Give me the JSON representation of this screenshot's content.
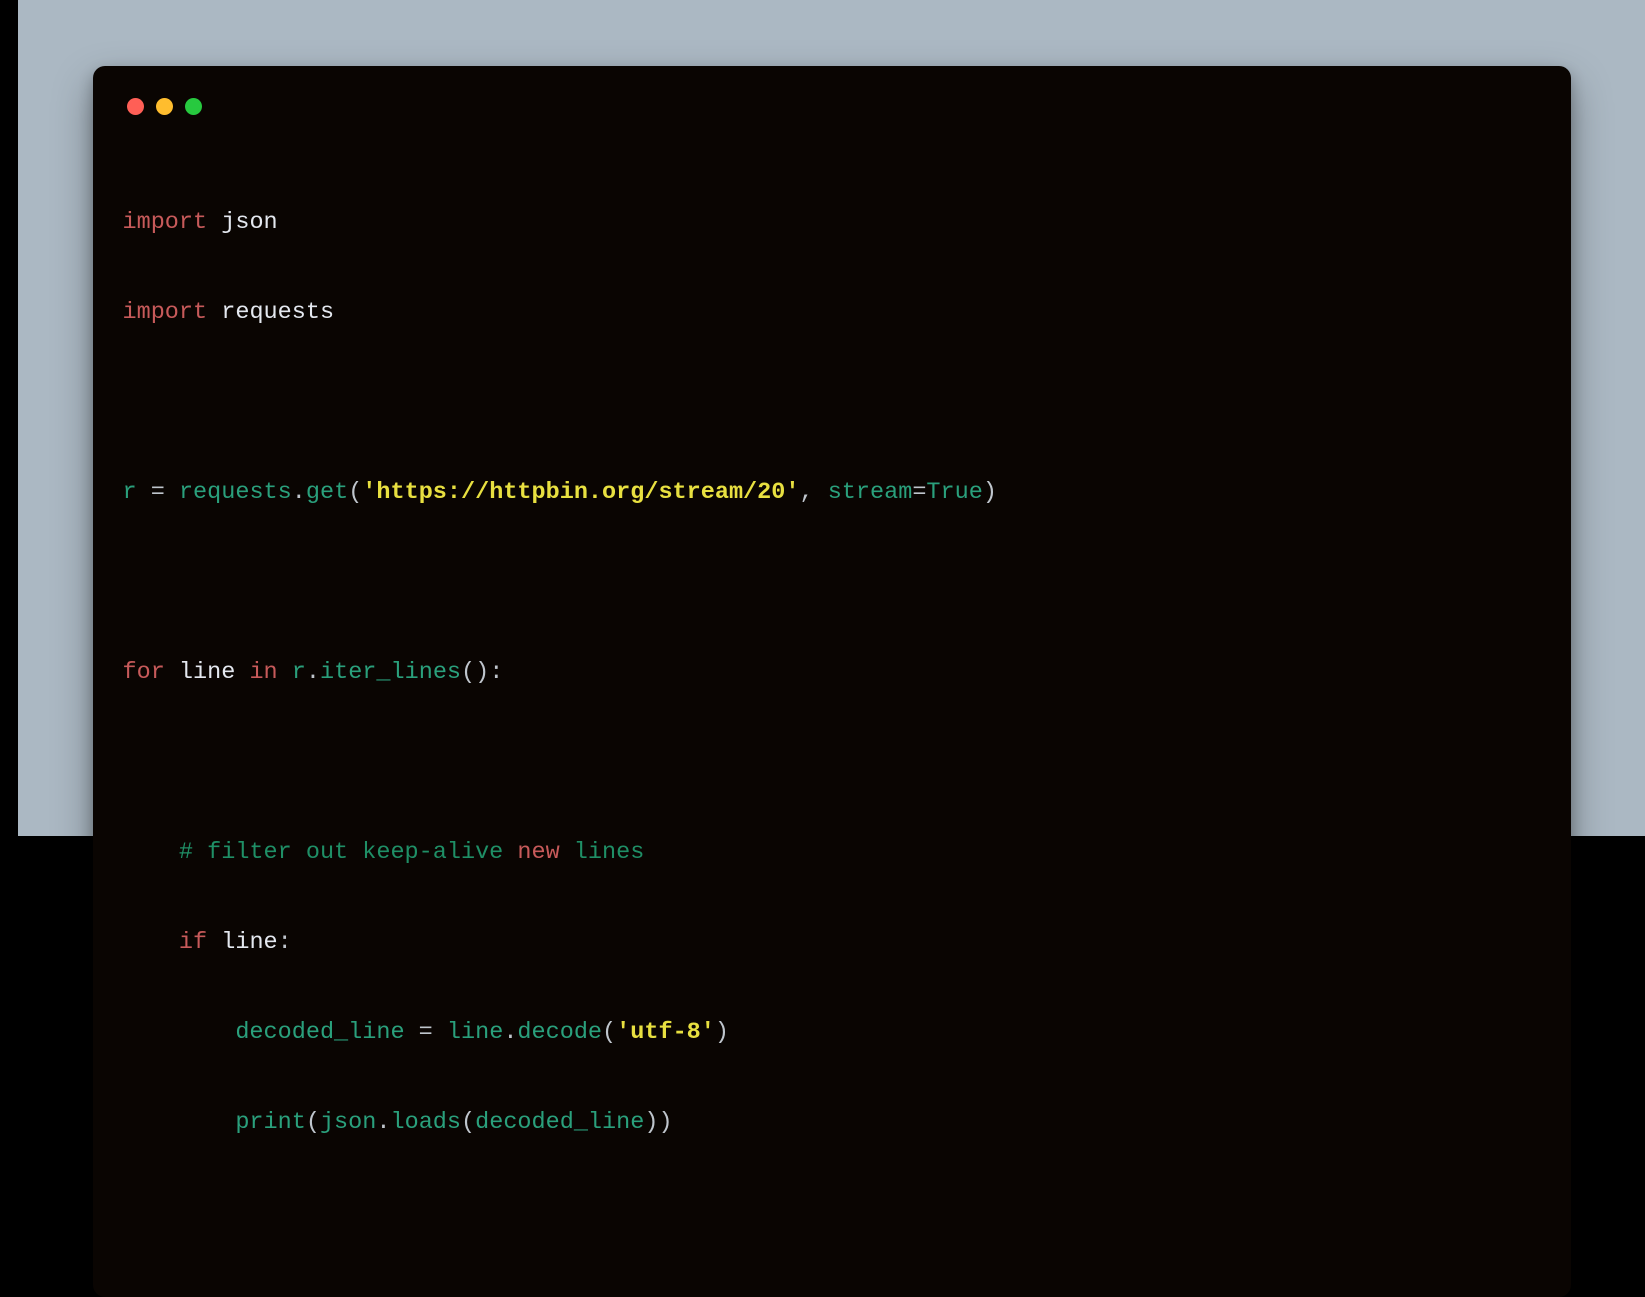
{
  "window": {
    "buttons": {
      "close": "close",
      "minimize": "minimize",
      "zoom": "zoom"
    }
  },
  "code": {
    "l1": {
      "kw": "import",
      "sp": " ",
      "name": "json"
    },
    "l2": {
      "kw": "import",
      "sp": " ",
      "name": "requests"
    },
    "l3": "",
    "l4": {
      "var": "r",
      "sp1": " ",
      "eq": "=",
      "sp2": " ",
      "mod": "requests",
      "dot": ".",
      "call": "get",
      "lpar": "(",
      "str": "'https://httpbin.org/stream/20'",
      "comma": ",",
      "sp3": " ",
      "kwarg": "stream",
      "eq2": "=",
      "const": "True",
      "rpar": ")"
    },
    "l5": "",
    "l6": {
      "for": "for",
      "sp1": " ",
      "line": "line",
      "sp2": " ",
      "in": "in",
      "sp3": " ",
      "r": "r",
      "dot": ".",
      "iter": "iter_lines",
      "call": "():"
    },
    "l7": "",
    "l8": {
      "indent": "    ",
      "c1": "# filter out keep-alive ",
      "c2": "new",
      "c3": " lines"
    },
    "l9": {
      "indent": "    ",
      "if": "if",
      "sp": " ",
      "line": "line",
      "colon": ":"
    },
    "l10": {
      "indent": "        ",
      "var": "decoded_line",
      "sp1": " ",
      "eq": "=",
      "sp2": " ",
      "line": "line",
      "dot": ".",
      "decode": "decode",
      "lpar": "(",
      "str": "'utf-8'",
      "rpar": ")"
    },
    "l11": {
      "indent": "        ",
      "print": "print",
      "lpar": "(",
      "json": "json",
      "dot": ".",
      "loads": "loads",
      "lpar2": "(",
      "arg": "decoded_line",
      "rpar2": ")",
      "rpar": ")"
    }
  }
}
